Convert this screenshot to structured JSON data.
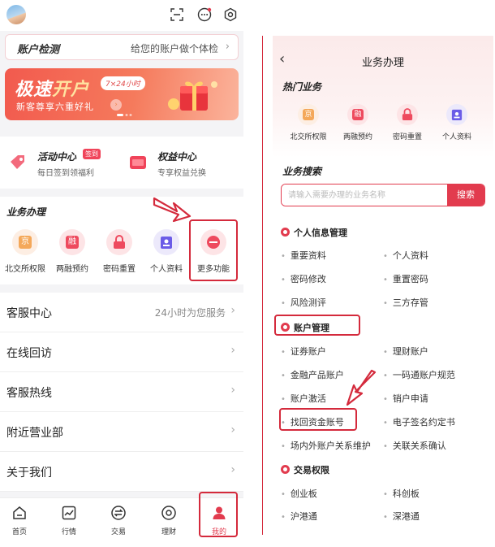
{
  "left": {
    "account_check": {
      "title": "账户检测",
      "subtitle": "给您的账户做个体检"
    },
    "banner": {
      "title_a": "极速",
      "title_b": "开户",
      "pill": "7×24小时",
      "subtitle": "新客尊享六重好礼"
    },
    "activity": {
      "center": {
        "title": "活动中心",
        "badge": "签到",
        "sub": "每日签到领福利"
      },
      "rights": {
        "title": "权益中心",
        "sub": "专享权益兑换"
      }
    },
    "business": {
      "heading": "业务办理",
      "items": [
        {
          "label": "北交所权限",
          "glyph": "京"
        },
        {
          "label": "两融预约",
          "glyph": "融"
        },
        {
          "label": "密码重置",
          "glyph": ""
        },
        {
          "label": "个人资料",
          "glyph": ""
        },
        {
          "label": "更多功能",
          "glyph": ""
        }
      ]
    },
    "menu": [
      {
        "label": "客服中心",
        "right": "24小时为您服务"
      },
      {
        "label": "在线回访",
        "right": ""
      },
      {
        "label": "客服热线",
        "right": ""
      },
      {
        "label": "附近营业部",
        "right": ""
      },
      {
        "label": "关于我们",
        "right": ""
      }
    ],
    "tabs": [
      {
        "label": "首页"
      },
      {
        "label": "行情"
      },
      {
        "label": "交易"
      },
      {
        "label": "理财"
      },
      {
        "label": "我的"
      }
    ]
  },
  "right": {
    "back": "‹",
    "title": "业务办理",
    "hot_heading": "热门业务",
    "hot": [
      {
        "label": "北交所权限",
        "glyph": "京"
      },
      {
        "label": "两融预约",
        "glyph": "融"
      },
      {
        "label": "密码重置",
        "glyph": ""
      },
      {
        "label": "个人资料",
        "glyph": ""
      }
    ],
    "search_heading": "业务搜索",
    "search_placeholder": "请输入需要办理的业务名称",
    "search_button": "搜索",
    "categories": [
      {
        "title": "个人信息管理",
        "items": [
          "重要资料",
          "个人资料",
          "密码修改",
          "重置密码",
          "风险测评",
          "三方存管"
        ]
      },
      {
        "title": "账户管理",
        "items": [
          "证券账户",
          "理财账户",
          "金融产品账户",
          "一码通账户规范",
          "账户激活",
          "销户申请",
          "找回资金账号",
          "电子签名约定书",
          "场内外账户关系维护",
          "关联关系确认"
        ]
      },
      {
        "title": "交易权限",
        "items": [
          "创业板",
          "科创板",
          "沪港通",
          "深港通"
        ]
      }
    ]
  },
  "colors": {
    "accent": "#e23b4e",
    "highlight": "#d42a3c"
  }
}
